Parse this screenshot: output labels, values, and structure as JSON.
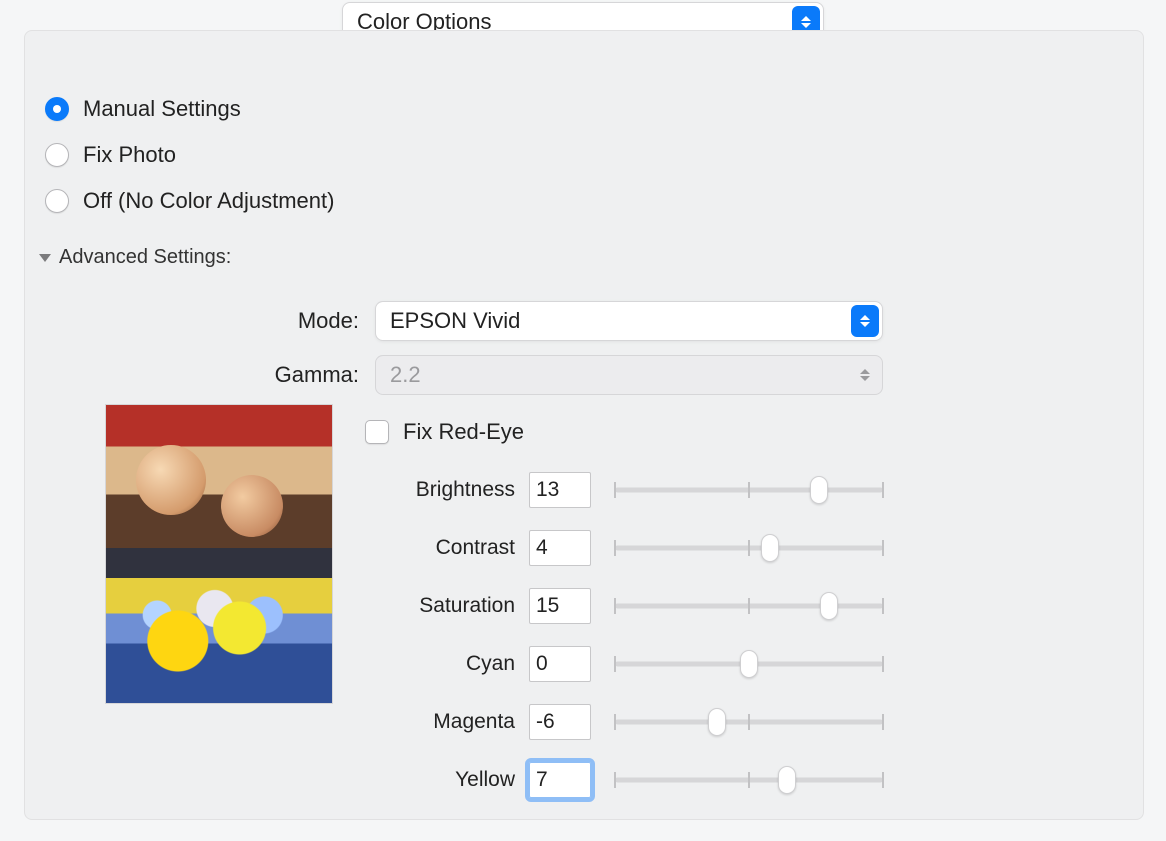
{
  "top_dropdown": {
    "value": "Color Options"
  },
  "radios": {
    "options": [
      {
        "label": "Manual Settings",
        "checked": true
      },
      {
        "label": "Fix Photo",
        "checked": false
      },
      {
        "label": "Off (No Color Adjustment)",
        "checked": false
      }
    ]
  },
  "disclosure": {
    "label": "Advanced Settings:",
    "expanded": true
  },
  "mode": {
    "label": "Mode:",
    "value": "EPSON Vivid"
  },
  "gamma": {
    "label": "Gamma:",
    "value": "2.2",
    "disabled": true
  },
  "fix_redeye": {
    "label": "Fix Red-Eye",
    "checked": false
  },
  "sliders": {
    "min": -25,
    "max": 25,
    "ticks": [
      -25,
      0,
      25
    ],
    "items": [
      {
        "label": "Brightness",
        "value": 13
      },
      {
        "label": "Contrast",
        "value": 4
      },
      {
        "label": "Saturation",
        "value": 15
      },
      {
        "label": "Cyan",
        "value": 0
      },
      {
        "label": "Magenta",
        "value": -6
      },
      {
        "label": "Yellow",
        "value": 7,
        "focused": true
      }
    ]
  }
}
